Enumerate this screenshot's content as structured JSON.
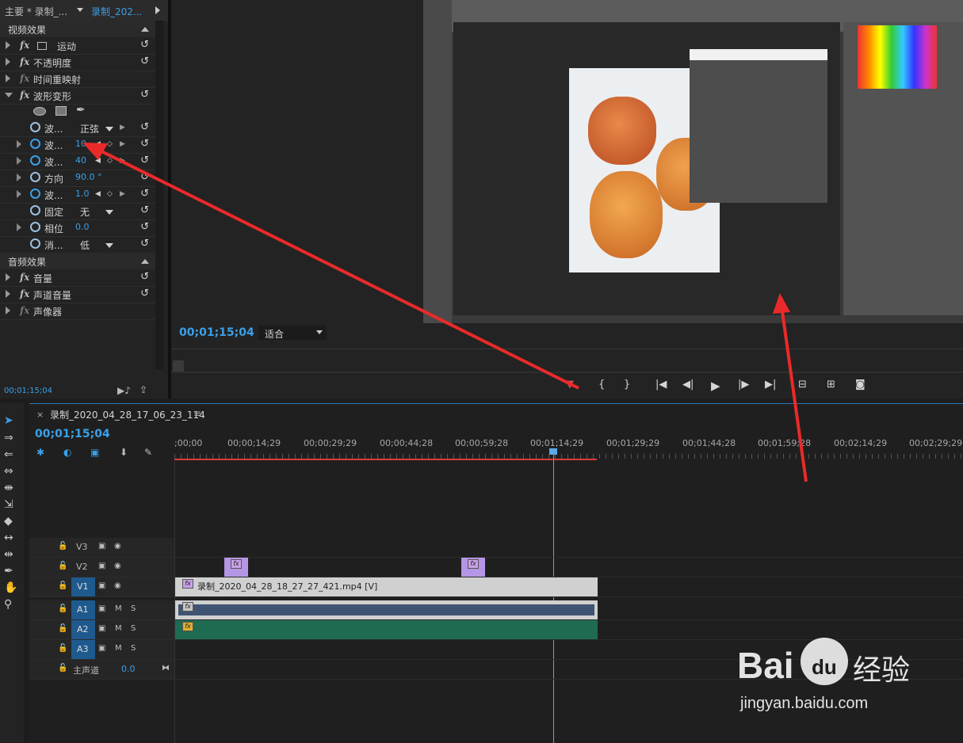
{
  "effect_controls": {
    "tab_main": "主要 * 录制_...",
    "tab_clip": "录制_202...",
    "video_section": "视频效果",
    "video_effects": [
      {
        "name": "运动"
      },
      {
        "name": "不透明度"
      },
      {
        "name": "时间重映射"
      },
      {
        "name": "波形变形"
      }
    ],
    "params": [
      {
        "label": "波...",
        "value": "正弦",
        "kind": "dropdown"
      },
      {
        "label": "波...",
        "value": "10",
        "kind": "value"
      },
      {
        "label": "波...",
        "value": "40",
        "kind": "value"
      },
      {
        "label": "方向",
        "value": "90.0 °",
        "kind": "value"
      },
      {
        "label": "波...",
        "value": "1.0",
        "kind": "value"
      },
      {
        "label": "固定",
        "value": "无",
        "kind": "dropdown"
      },
      {
        "label": "相位",
        "value": "0.0",
        "kind": "value"
      },
      {
        "label": "消...",
        "value": "低",
        "kind": "dropdown"
      }
    ],
    "audio_section": "音频效果",
    "audio_effects": [
      {
        "name": "音量"
      },
      {
        "name": "声道音量"
      },
      {
        "name": "声像器"
      }
    ],
    "timecode": "00;01;15;04"
  },
  "program_monitor": {
    "timecode": "00;01;15;04",
    "fit": "适合"
  },
  "timeline": {
    "sequence_name": "录制_2020_04_28_17_06_23_114",
    "timecode": "00;01;15;04",
    "ruler": [
      ";00;00",
      "00;00;14;29",
      "00;00;29;29",
      "00;00;44;28",
      "00;00;59;28",
      "00;01;14;29",
      "00;01;29;29",
      "00;01;44;28",
      "00;01;59;28",
      "00;02;14;29",
      "00;02;29;29"
    ],
    "tracks": {
      "v3": "V3",
      "v2": "V2",
      "v1": "V1",
      "a1": "A1",
      "a2": "A2",
      "a3": "A3",
      "m": "M",
      "s": "S",
      "master": "主声道",
      "master_value": "0.0"
    },
    "clip_name": "录制_2020_04_28_18_27_27_421.mp4 [V]"
  },
  "watermark": {
    "brand": "Bai",
    "brand2": "du",
    "cn": "经验",
    "url": "jingyan.baidu.com"
  },
  "colors": {
    "accent": "#3aa0e8",
    "playhead": "#5aaae6",
    "audio_a1": "#3f5373",
    "audio_a2": "#1f6b52",
    "fx_clip": "#b596e6"
  }
}
